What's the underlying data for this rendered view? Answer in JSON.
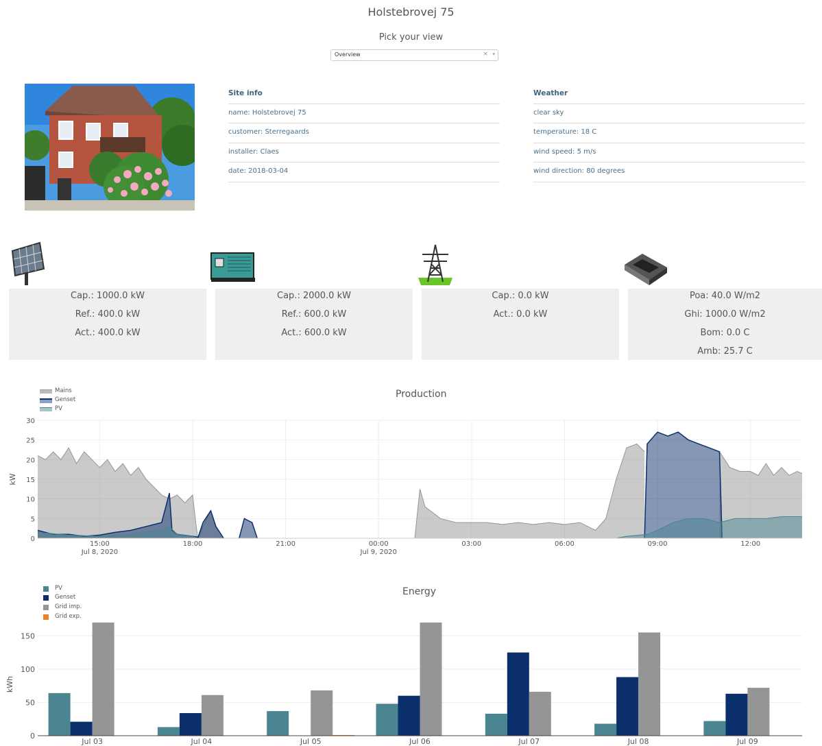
{
  "header": {
    "title": "Holstebrovej 75",
    "picker_label": "Pick your view"
  },
  "view_select": {
    "value": "Overview",
    "clear_icon": "×",
    "caret_icon": "▾"
  },
  "site_info": {
    "heading": "Site info",
    "rows": [
      "name: Holstebrovej 75",
      "customer: Sterregaards",
      "installer: Claes",
      "date: 2018-03-04"
    ]
  },
  "weather": {
    "heading": "Weather",
    "rows": [
      "clear sky",
      "temperature: 18 C",
      "wind speed: 5 m/s",
      "wind direction: 80 degrees"
    ]
  },
  "assets": [
    {
      "icon": "solar-panel-icon",
      "lines": [
        "Cap.: 1000.0 kW",
        "Ref.: 400.0 kW",
        "Act.: 400.0 kW"
      ]
    },
    {
      "icon": "generator-icon",
      "lines": [
        "Cap.: 2000.0 kW",
        "Ref.: 600.0 kW",
        "Act.: 600.0 kW"
      ]
    },
    {
      "icon": "power-pylon-icon",
      "lines": [
        "Cap.: 0.0 kW",
        "Act.: 0.0 kW"
      ]
    },
    {
      "icon": "sensor-device-icon",
      "lines": [
        "Poa: 40.0 W/m2",
        "Ghi: 1000.0 W/m2",
        "Bom: 0.0 C",
        "Amb: 25.7 C"
      ]
    }
  ],
  "colors": {
    "pv": "#4a8591",
    "genset": "#0b2f6b",
    "mains": "#959595",
    "grid_exp": "#e8812a"
  },
  "chart_data": [
    {
      "type": "area",
      "title": "Production",
      "ylabel": "kW",
      "ylim": [
        0,
        30
      ],
      "yticks": [
        "0",
        "5",
        "10",
        "15",
        "20",
        "25",
        "30"
      ],
      "xticks": [
        {
          "x": "2020-07-08 15:00",
          "label": "15:00",
          "sub": "Jul 8, 2020"
        },
        {
          "x": "2020-07-08 18:00",
          "label": "18:00",
          "sub": ""
        },
        {
          "x": "2020-07-08 21:00",
          "label": "21:00",
          "sub": ""
        },
        {
          "x": "2020-07-09 00:00",
          "label": "00:00",
          "sub": "Jul 9, 2020"
        },
        {
          "x": "2020-07-09 03:00",
          "label": "03:00",
          "sub": ""
        },
        {
          "x": "2020-07-09 06:00",
          "label": "06:00",
          "sub": ""
        },
        {
          "x": "2020-07-09 09:00",
          "label": "09:00",
          "sub": ""
        },
        {
          "x": "2020-07-09 12:00",
          "label": "12:00",
          "sub": ""
        }
      ],
      "xrange": [
        "2020-07-08 13:00",
        "2020-07-09 13:40"
      ],
      "series": [
        {
          "name": "Mains",
          "color": "#959595",
          "segments": [
            [
              [
                "2020-07-08 13:00",
                21
              ],
              [
                "2020-07-08 13:15",
                20
              ],
              [
                "2020-07-08 13:30",
                22
              ],
              [
                "2020-07-08 13:45",
                20
              ],
              [
                "2020-07-08 14:00",
                23
              ],
              [
                "2020-07-08 14:15",
                19
              ],
              [
                "2020-07-08 14:30",
                22
              ],
              [
                "2020-07-08 14:45",
                20
              ],
              [
                "2020-07-08 15:00",
                18
              ],
              [
                "2020-07-08 15:15",
                20
              ],
              [
                "2020-07-08 15:30",
                17
              ],
              [
                "2020-07-08 15:45",
                19
              ],
              [
                "2020-07-08 16:00",
                16
              ],
              [
                "2020-07-08 16:15",
                18
              ],
              [
                "2020-07-08 16:30",
                15
              ],
              [
                "2020-07-08 16:45",
                13
              ],
              [
                "2020-07-08 17:00",
                11
              ],
              [
                "2020-07-08 17:15",
                10
              ],
              [
                "2020-07-08 17:30",
                11
              ],
              [
                "2020-07-08 17:45",
                9
              ],
              [
                "2020-07-08 18:00",
                11
              ],
              [
                "2020-07-08 18:05",
                5
              ],
              [
                "2020-07-08 18:10",
                0
              ]
            ],
            [
              [
                "2020-07-08 18:10",
                0
              ],
              [
                "2020-07-08 18:20",
                3
              ],
              [
                "2020-07-08 18:35",
                7
              ],
              [
                "2020-07-08 18:45",
                3
              ],
              [
                "2020-07-08 19:00",
                0
              ]
            ],
            [
              [
                "2020-07-09 01:10",
                0
              ],
              [
                "2020-07-09 01:20",
                12.5
              ],
              [
                "2020-07-09 01:30",
                8
              ],
              [
                "2020-07-09 02:00",
                5
              ],
              [
                "2020-07-09 02:30",
                4
              ],
              [
                "2020-07-09 03:00",
                4
              ],
              [
                "2020-07-09 03:30",
                4
              ],
              [
                "2020-07-09 04:00",
                3.5
              ],
              [
                "2020-07-09 04:30",
                4
              ],
              [
                "2020-07-09 05:00",
                3.5
              ],
              [
                "2020-07-09 05:30",
                4
              ],
              [
                "2020-07-09 06:00",
                3.5
              ],
              [
                "2020-07-09 06:30",
                4
              ],
              [
                "2020-07-09 07:00",
                2
              ],
              [
                "2020-07-09 07:20",
                5
              ],
              [
                "2020-07-09 07:40",
                15
              ],
              [
                "2020-07-09 08:00",
                23
              ],
              [
                "2020-07-09 08:20",
                24
              ],
              [
                "2020-07-09 08:35",
                22
              ]
            ],
            [
              [
                "2020-07-09 11:00",
                22
              ],
              [
                "2020-07-09 11:20",
                18
              ],
              [
                "2020-07-09 11:40",
                17
              ],
              [
                "2020-07-09 12:00",
                17
              ],
              [
                "2020-07-09 12:15",
                16
              ],
              [
                "2020-07-09 12:30",
                19
              ],
              [
                "2020-07-09 12:45",
                16
              ],
              [
                "2020-07-09 13:00",
                18
              ],
              [
                "2020-07-09 13:15",
                16
              ],
              [
                "2020-07-09 13:30",
                17
              ],
              [
                "2020-07-09 13:40",
                16.5
              ]
            ]
          ]
        },
        {
          "name": "Genset",
          "color": "#0b2f6b",
          "segments": [
            [
              [
                "2020-07-08 13:00",
                2
              ],
              [
                "2020-07-08 13:30",
                1
              ],
              [
                "2020-07-08 14:00",
                1
              ],
              [
                "2020-07-08 14:30",
                0.5
              ],
              [
                "2020-07-08 15:00",
                0.8
              ],
              [
                "2020-07-08 15:30",
                1.5
              ],
              [
                "2020-07-08 16:00",
                2
              ],
              [
                "2020-07-08 16:30",
                3
              ],
              [
                "2020-07-08 17:00",
                4
              ],
              [
                "2020-07-08 17:15",
                11.5
              ],
              [
                "2020-07-08 17:20",
                2
              ],
              [
                "2020-07-08 17:30",
                1
              ],
              [
                "2020-07-08 18:00",
                0.5
              ],
              [
                "2020-07-08 18:10",
                0.3
              ]
            ],
            [
              [
                "2020-07-08 18:10",
                0
              ],
              [
                "2020-07-08 18:20",
                4
              ],
              [
                "2020-07-08 18:35",
                7
              ],
              [
                "2020-07-08 18:45",
                3
              ],
              [
                "2020-07-08 19:00",
                0
              ]
            ],
            [
              [
                "2020-07-08 19:30",
                0
              ],
              [
                "2020-07-08 19:40",
                5
              ],
              [
                "2020-07-08 19:55",
                4
              ],
              [
                "2020-07-08 20:05",
                0
              ]
            ],
            [
              [
                "2020-07-09 08:35",
                0
              ],
              [
                "2020-07-09 08:40",
                24
              ],
              [
                "2020-07-09 09:00",
                27
              ],
              [
                "2020-07-09 09:20",
                26
              ],
              [
                "2020-07-09 09:40",
                27
              ],
              [
                "2020-07-09 10:00",
                25
              ],
              [
                "2020-07-09 10:20",
                24
              ],
              [
                "2020-07-09 10:40",
                23
              ],
              [
                "2020-07-09 11:00",
                22
              ],
              [
                "2020-07-09 11:05",
                0
              ]
            ]
          ]
        },
        {
          "name": "PV",
          "color": "#4a8591",
          "segments": [
            [
              [
                "2020-07-08 13:00",
                1.5
              ],
              [
                "2020-07-08 14:00",
                0.8
              ],
              [
                "2020-07-08 15:00",
                0.5
              ],
              [
                "2020-07-08 16:00",
                1
              ],
              [
                "2020-07-08 17:00",
                2
              ],
              [
                "2020-07-08 17:15",
                3
              ],
              [
                "2020-07-08 17:30",
                1
              ],
              [
                "2020-07-08 18:00",
                0.5
              ],
              [
                "2020-07-08 18:10",
                0
              ]
            ],
            [
              [
                "2020-07-09 07:40",
                0
              ],
              [
                "2020-07-09 08:00",
                0.5
              ],
              [
                "2020-07-09 08:40",
                1
              ],
              [
                "2020-07-09 09:00",
                2
              ],
              [
                "2020-07-09 09:30",
                4
              ],
              [
                "2020-07-09 10:00",
                5
              ],
              [
                "2020-07-09 10:30",
                5
              ],
              [
                "2020-07-09 11:00",
                4
              ],
              [
                "2020-07-09 11:30",
                5
              ],
              [
                "2020-07-09 12:00",
                5
              ],
              [
                "2020-07-09 12:30",
                5
              ],
              [
                "2020-07-09 13:00",
                5.5
              ],
              [
                "2020-07-09 13:40",
                5.5
              ]
            ]
          ]
        }
      ]
    },
    {
      "type": "bar",
      "title": "Energy",
      "ylabel": "kWh",
      "ylim": [
        0,
        175
      ],
      "yticks": [
        0,
        50,
        100,
        150
      ],
      "categories": [
        "Jul 03",
        "Jul 04",
        "Jul 05",
        "Jul 06",
        "Jul 07",
        "Jul 08",
        "Jul 09"
      ],
      "series": [
        {
          "name": "PV",
          "color": "#4a8591",
          "values": [
            64,
            13,
            37,
            48,
            33,
            18,
            22
          ]
        },
        {
          "name": "Genset",
          "color": "#0b2f6b",
          "values": [
            21,
            34,
            0,
            60,
            125,
            88,
            63
          ]
        },
        {
          "name": "Grid imp.",
          "color": "#959595",
          "values": [
            170,
            61,
            68,
            170,
            66,
            155,
            72
          ]
        },
        {
          "name": "Grid exp.",
          "color": "#e8812a",
          "values": [
            0.5,
            0,
            1,
            0,
            0,
            0,
            0
          ]
        }
      ]
    }
  ]
}
